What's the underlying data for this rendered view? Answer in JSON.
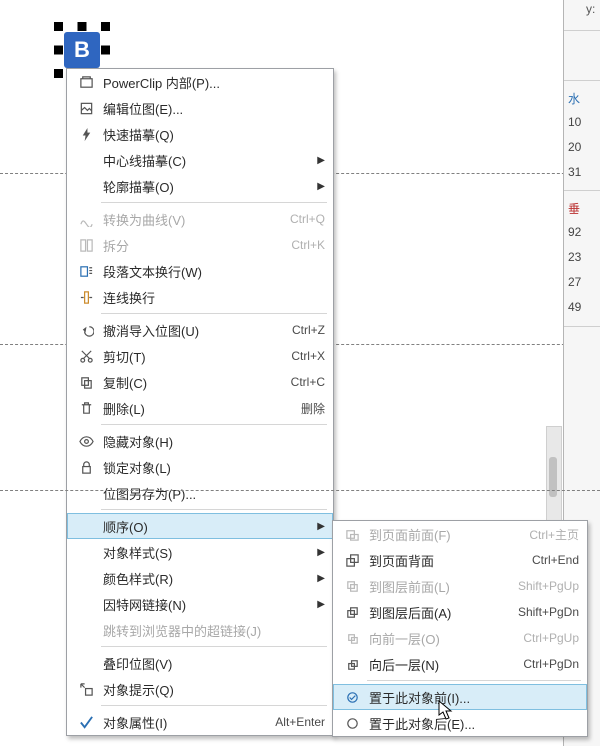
{
  "canvas": {
    "logo_letter": "B"
  },
  "right_panel": {
    "y_label": "y:",
    "header1": "水",
    "v1": "10",
    "v2": "20",
    "v3": "31",
    "header2": "垂",
    "v4": "92",
    "v5": "23",
    "v6": "27",
    "v7": "49"
  },
  "menu": {
    "powerclip": "PowerClip 内部(P)...",
    "edit_bitmap": "编辑位图(E)...",
    "quick_trace": "快速描摹(Q)",
    "center_trace": "中心线描摹(C)",
    "outline_trace": "轮廓描摹(O)",
    "to_curve": "转换为曲线(V)",
    "to_curve_sc": "Ctrl+Q",
    "split": "拆分",
    "split_sc": "Ctrl+K",
    "para_wrap": "段落文本换行(W)",
    "conn_wrap": "连线换行",
    "undo": "撤消导入位图(U)",
    "undo_sc": "Ctrl+Z",
    "cut": "剪切(T)",
    "cut_sc": "Ctrl+X",
    "copy": "复制(C)",
    "copy_sc": "Ctrl+C",
    "delete": "删除(L)",
    "delete_sc": "删除",
    "hide": "隐藏对象(H)",
    "lock": "锁定对象(L)",
    "save_bitmap": "位图另存为(P)...",
    "order": "顺序(O)",
    "obj_styles": "对象样式(S)",
    "color_styles": "颜色样式(R)",
    "hyperlink": "因特网链接(N)",
    "goto_hyperlink": "跳转到浏览器中的超链接(J)",
    "overprint_bmp": "叠印位图(V)",
    "obj_hint": "对象提示(Q)",
    "properties": "对象属性(I)",
    "properties_sc": "Alt+Enter"
  },
  "submenu": {
    "to_page_front": "到页面前面(F)",
    "to_page_front_sc": "Ctrl+主页",
    "to_page_back": "到页面背面",
    "to_page_back_sc": "Ctrl+End",
    "to_layer_front": "到图层前面(L)",
    "to_layer_front_sc": "Shift+PgUp",
    "to_layer_back": "到图层后面(A)",
    "to_layer_back_sc": "Shift+PgDn",
    "forward_one": "向前一层(O)",
    "forward_one_sc": "Ctrl+PgUp",
    "back_one": "向后一层(N)",
    "back_one_sc": "Ctrl+PgDn",
    "before_obj": "置于此对象前(I)...",
    "after_obj": "置于此对象后(E)..."
  }
}
